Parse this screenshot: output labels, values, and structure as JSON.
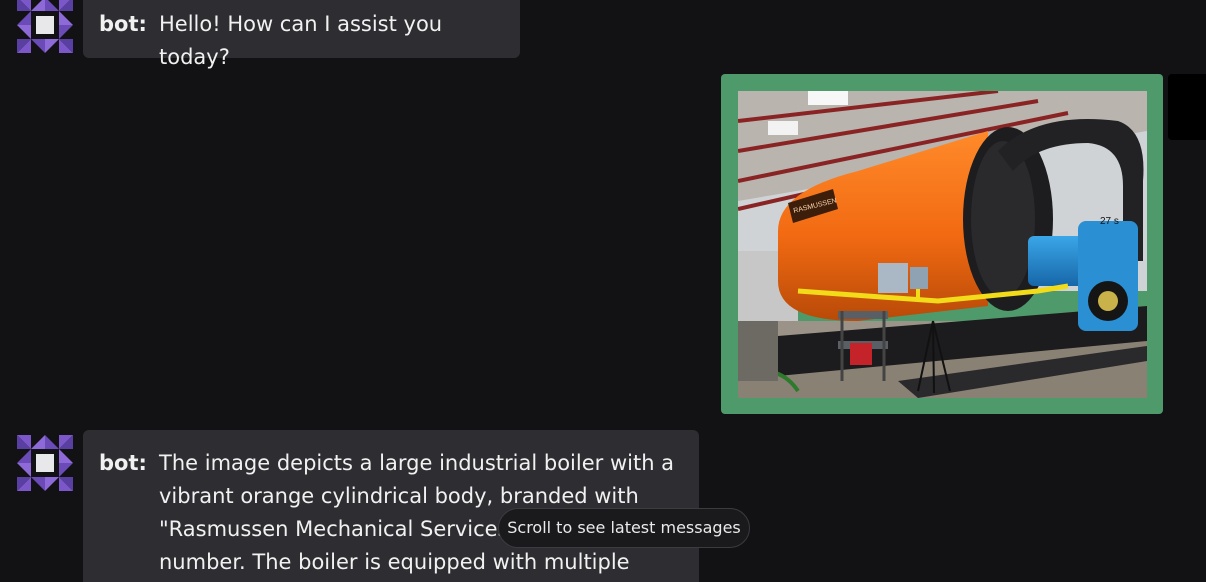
{
  "messages": [
    {
      "role": "bot",
      "speaker": "bot:",
      "text": "Hello! How can I assist you today?",
      "avatar_icon": "quilt-star-icon"
    },
    {
      "role": "user",
      "type": "image",
      "image_subject": "orange industrial boiler in a workshop",
      "frame_color": "#4f9a6b"
    },
    {
      "role": "bot",
      "speaker": "bot:",
      "text": "The image depicts a large industrial boiler with a vibrant orange cylindrical body, branded with \"Rasmussen Mechanical Services\" and a phone number. The boiler is equipped with multiple",
      "avatar_icon": "quilt-star-icon"
    }
  ],
  "scroll_hint": {
    "label": "Scroll to see latest messages"
  },
  "photo_labels": {
    "brand": "RASMUSSEN",
    "tag": "27 s"
  },
  "colors": {
    "background": "#121114",
    "bot_bubble": "#2e2d31",
    "avatar_purple": "#7b57c9"
  }
}
